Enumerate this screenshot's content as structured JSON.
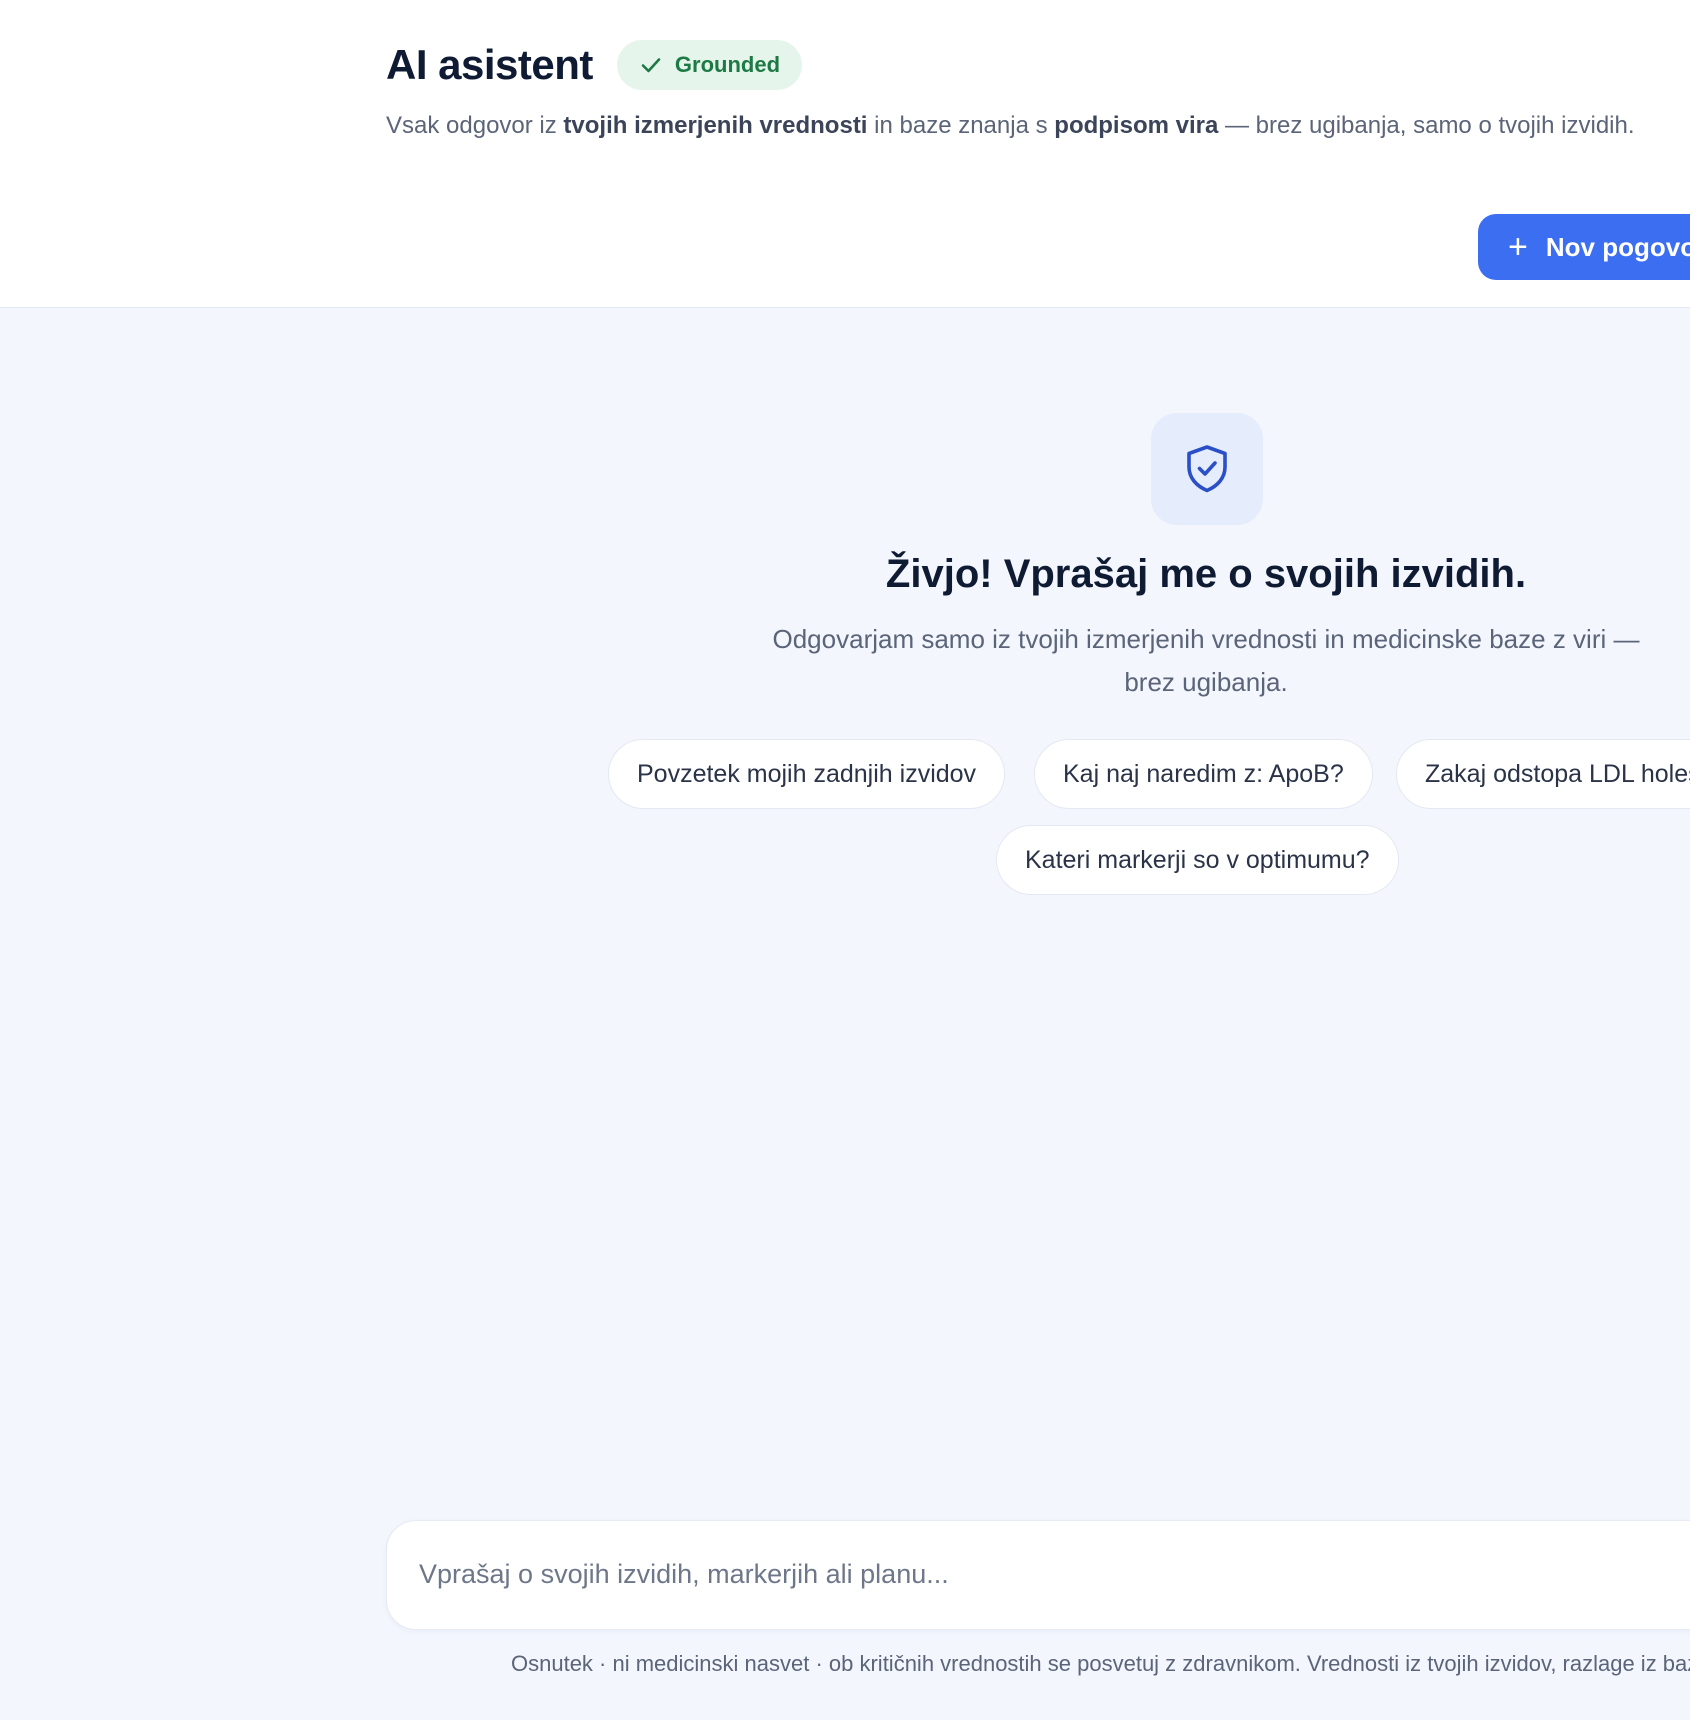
{
  "header": {
    "title": "AI asistent",
    "badge_label": "Grounded",
    "subtitle_parts": {
      "p1": "Vsak odgovor iz ",
      "b1": "tvojih izmerjenih vrednosti",
      "p2": " in baze znanja s ",
      "b2": "podpisom vira",
      "p3": " — brez ugibanja, samo o tvojih izvidih."
    },
    "new_button_label": "Nov pogovor"
  },
  "welcome": {
    "title": "Živjo! Vprašaj me o svojih izvidih.",
    "subtitle": "Odgovarjam samo iz tvojih izmerjenih vrednosti in medicinske baze z viri — brez ugibanja."
  },
  "suggestions": [
    "Povzetek mojih zadnjih izvidov",
    "Kaj naj naredim z: ApoB?",
    "Zakaj odstopa LDL holesterol?",
    "Kateri markerji so v optimumu?"
  ],
  "composer": {
    "placeholder": "Vprašaj o svojih izvidih, markerjih ali planu..."
  },
  "footer": {
    "disclaimer": "Osnutek · ni medicinski nasvet · ob kritičnih vrednostih se posvetuj z zdravnikom. Vrednosti iz tvojih izvidov, razlage iz baze znanja."
  },
  "colors": {
    "accent": "#3b6ef0",
    "badge_bg": "#e6f5ec",
    "badge_text": "#1e7a45",
    "page_bg": "#f3f6fd"
  },
  "icons": {
    "badge": "check-icon",
    "button": "plus-icon",
    "welcome": "shield-check-icon"
  }
}
